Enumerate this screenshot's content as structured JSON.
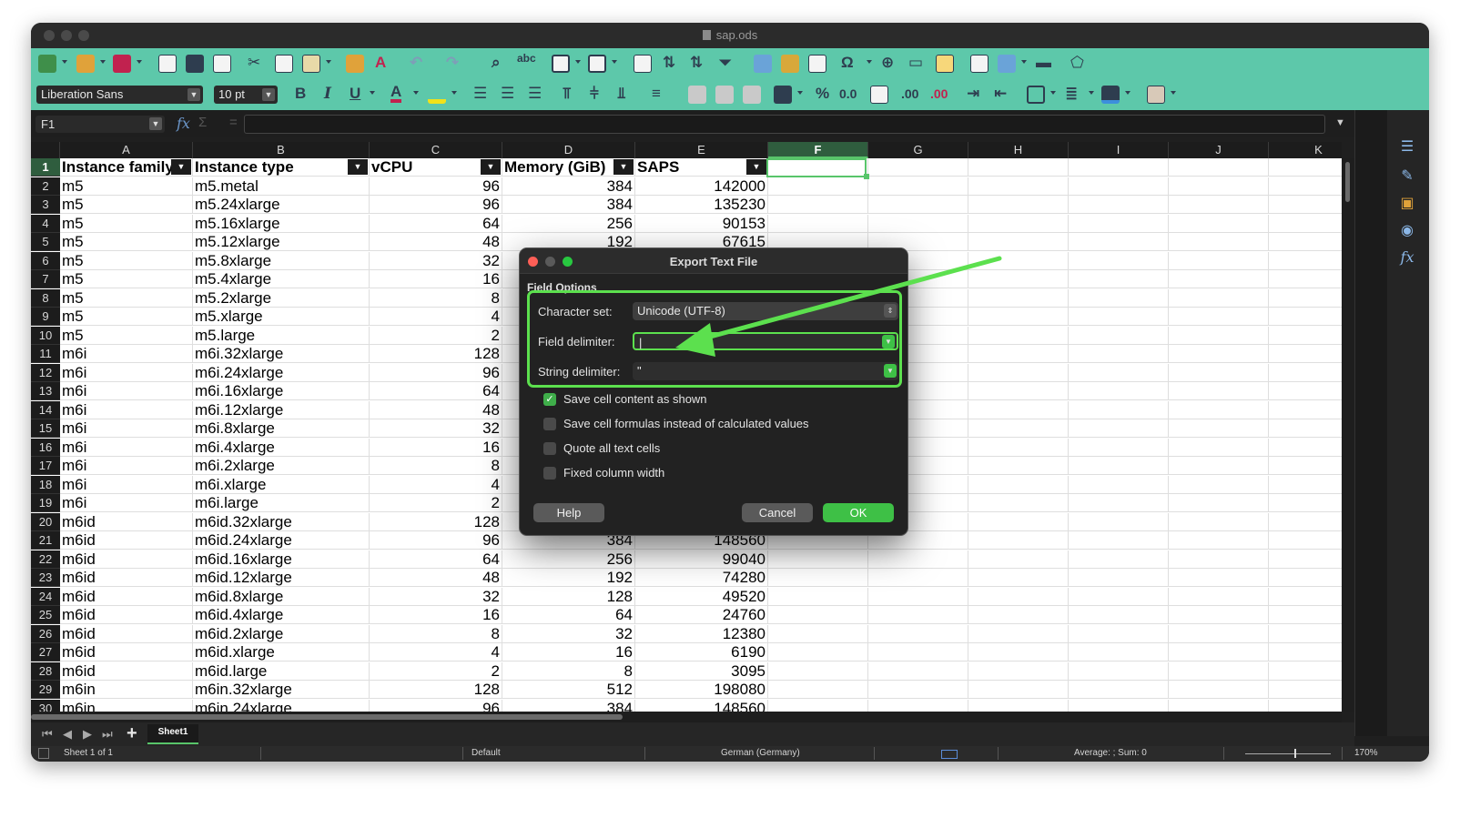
{
  "window": {
    "title": "sap.ods"
  },
  "toolbar": {
    "font_name": "Liberation Sans",
    "font_size": "10 pt",
    "bold": "B",
    "italic": "I",
    "underline": "U",
    "percent": "%",
    "decimal": "0.0",
    "add_decimal": ".00",
    "del_decimal": ".00"
  },
  "formula_bar": {
    "name_box": "F1",
    "content": ""
  },
  "columns": [
    "A",
    "B",
    "C",
    "D",
    "E",
    "F",
    "G",
    "H",
    "I",
    "J",
    "K"
  ],
  "selected_column": "F",
  "headers": [
    "Instance family",
    "Instance type",
    "vCPU",
    "Memory (GiB)",
    "SAPS"
  ],
  "rows": [
    [
      "m5",
      "m5.metal",
      "96",
      "384",
      "142000"
    ],
    [
      "m5",
      "m5.24xlarge",
      "96",
      "384",
      "135230"
    ],
    [
      "m5",
      "m5.16xlarge",
      "64",
      "256",
      "90153"
    ],
    [
      "m5",
      "m5.12xlarge",
      "48",
      "192",
      "67615"
    ],
    [
      "m5",
      "m5.8xlarge",
      "32",
      "",
      ""
    ],
    [
      "m5",
      "m5.4xlarge",
      "16",
      "",
      ""
    ],
    [
      "m5",
      "m5.2xlarge",
      "8",
      "",
      ""
    ],
    [
      "m5",
      "m5.xlarge",
      "4",
      "",
      ""
    ],
    [
      "m5",
      "m5.large",
      "2",
      "",
      ""
    ],
    [
      "m6i",
      "m6i.32xlarge",
      "128",
      "",
      ""
    ],
    [
      "m6i",
      "m6i.24xlarge",
      "96",
      "",
      ""
    ],
    [
      "m6i",
      "m6i.16xlarge",
      "64",
      "",
      ""
    ],
    [
      "m6i",
      "m6i.12xlarge",
      "48",
      "",
      ""
    ],
    [
      "m6i",
      "m6i.8xlarge",
      "32",
      "",
      ""
    ],
    [
      "m6i",
      "m6i.4xlarge",
      "16",
      "",
      ""
    ],
    [
      "m6i",
      "m6i.2xlarge",
      "8",
      "",
      ""
    ],
    [
      "m6i",
      "m6i.xlarge",
      "4",
      "",
      ""
    ],
    [
      "m6i",
      "m6i.large",
      "2",
      "",
      ""
    ],
    [
      "m6id",
      "m6id.32xlarge",
      "128",
      "",
      ""
    ],
    [
      "m6id",
      "m6id.24xlarge",
      "96",
      "384",
      "148560"
    ],
    [
      "m6id",
      "m6id.16xlarge",
      "64",
      "256",
      "99040"
    ],
    [
      "m6id",
      "m6id.12xlarge",
      "48",
      "192",
      "74280"
    ],
    [
      "m6id",
      "m6id.8xlarge",
      "32",
      "128",
      "49520"
    ],
    [
      "m6id",
      "m6id.4xlarge",
      "16",
      "64",
      "24760"
    ],
    [
      "m6id",
      "m6id.2xlarge",
      "8",
      "32",
      "12380"
    ],
    [
      "m6id",
      "m6id.xlarge",
      "4",
      "16",
      "6190"
    ],
    [
      "m6id",
      "m6id.large",
      "2",
      "8",
      "3095"
    ],
    [
      "m6in",
      "m6in.32xlarge",
      "128",
      "512",
      "198080"
    ],
    [
      "m6in",
      "m6in.24xlarge",
      "96",
      "384",
      "148560"
    ]
  ],
  "sheet_tab": "Sheet1",
  "status": {
    "sheet": "Sheet 1 of 1",
    "style": "Default",
    "language": "German (Germany)",
    "sum": "Average: ; Sum: 0",
    "zoom": "170%"
  },
  "dialog": {
    "title": "Export Text File",
    "section": "Field Options",
    "charset_label": "Character set:",
    "charset_value": "Unicode (UTF-8)",
    "field_delim_label": "Field delimiter:",
    "field_delim_value": "|",
    "string_delim_label": "String delimiter:",
    "string_delim_value": "\"",
    "options": [
      {
        "label": "Save cell content as shown",
        "checked": true
      },
      {
        "label": "Save cell formulas instead of calculated values",
        "checked": false
      },
      {
        "label": "Quote all text cells",
        "checked": false
      },
      {
        "label": "Fixed column width",
        "checked": false
      }
    ],
    "help": "Help",
    "cancel": "Cancel",
    "ok": "OK"
  },
  "colors": {
    "toolbar": "#5dc8aa",
    "highlight": "#5ce04e",
    "ok": "#3ec046"
  }
}
